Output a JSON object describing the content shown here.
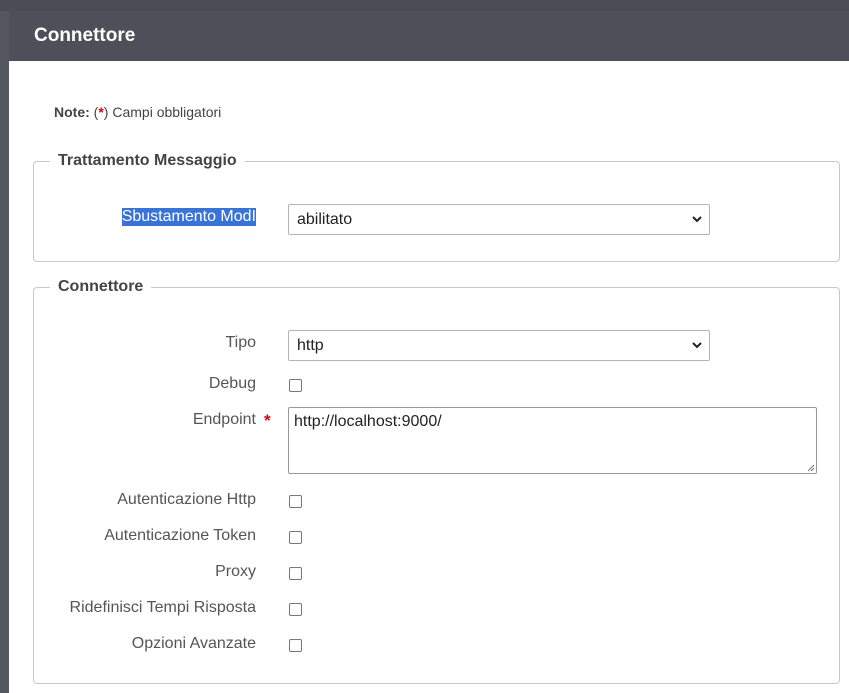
{
  "header": {
    "title": "Connettore"
  },
  "note": {
    "prefix": "Note:",
    "open": " (",
    "star": "*",
    "text": ") Campi obbligatori"
  },
  "trattamento": {
    "legend": "Trattamento Messaggio",
    "sbustamento_label": "Sbustamento ModI",
    "sbustamento_value": "abilitato"
  },
  "connettore": {
    "legend": "Connettore",
    "tipo_label": "Tipo",
    "tipo_value": "http",
    "debug_label": "Debug",
    "endpoint_label": "Endpoint",
    "endpoint_required": "*",
    "endpoint_value": "http://localhost:9000/",
    "auth_http_label": "Autenticazione Http",
    "auth_token_label": "Autenticazione Token",
    "proxy_label": "Proxy",
    "tempi_label": "Ridefinisci Tempi Risposta",
    "opzioni_label": "Opzioni Avanzate"
  },
  "colors": {
    "header_bg": "#4d5059",
    "required": "#d0021b",
    "selection": "#3874d8"
  }
}
